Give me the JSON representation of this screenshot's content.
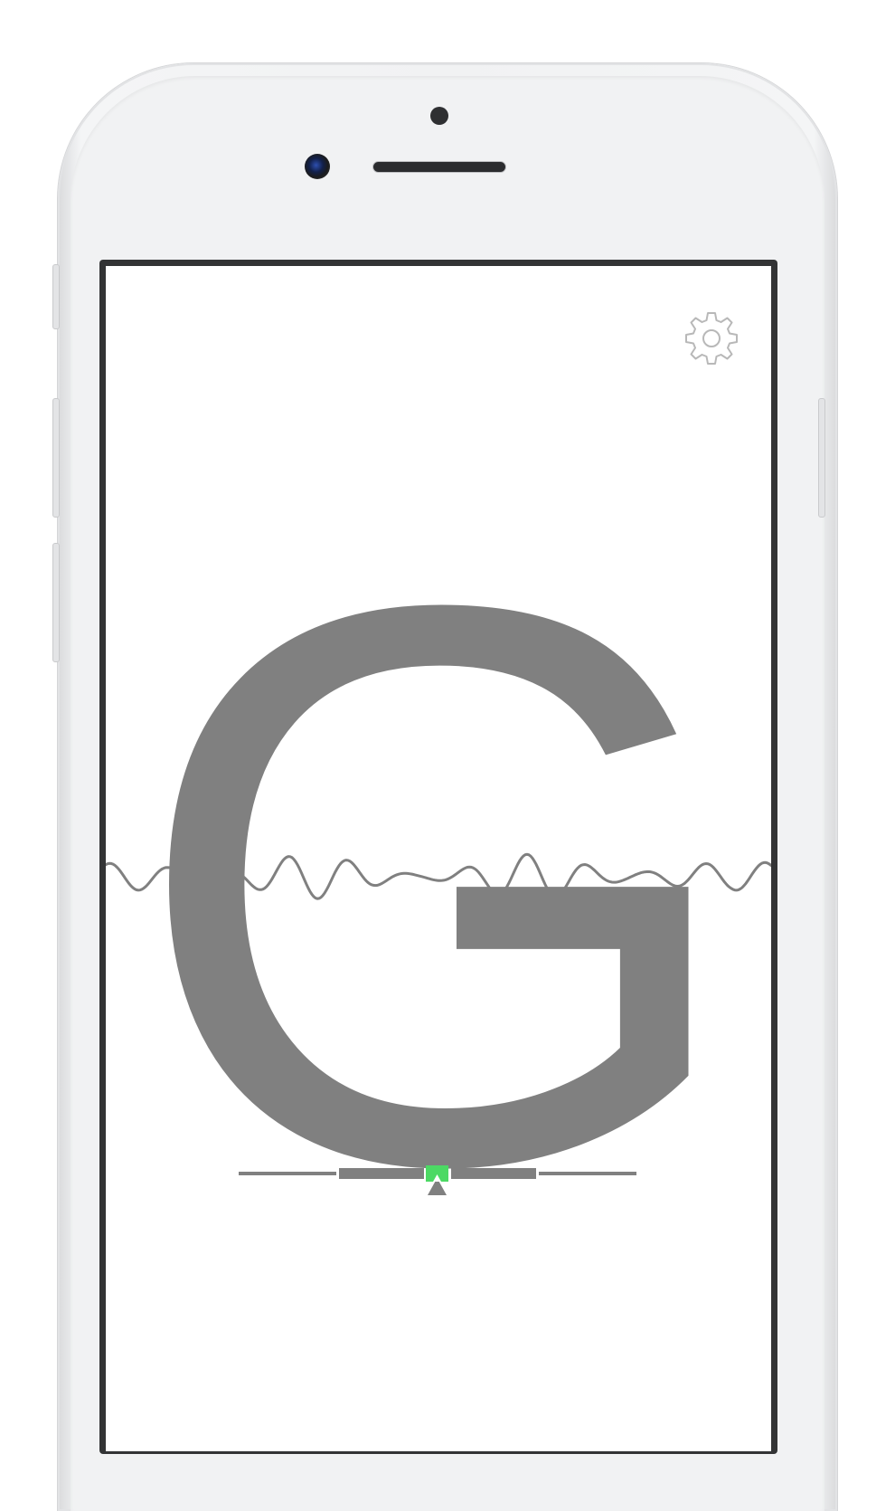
{
  "app": {
    "settings_icon": "gear-icon",
    "note": "G",
    "text_color": "#808080",
    "in_tune_color": "#4cd964"
  },
  "tuning_meter": {
    "indicator_icon": "triangle-up-icon",
    "segments": 5,
    "active_segment": "center"
  }
}
